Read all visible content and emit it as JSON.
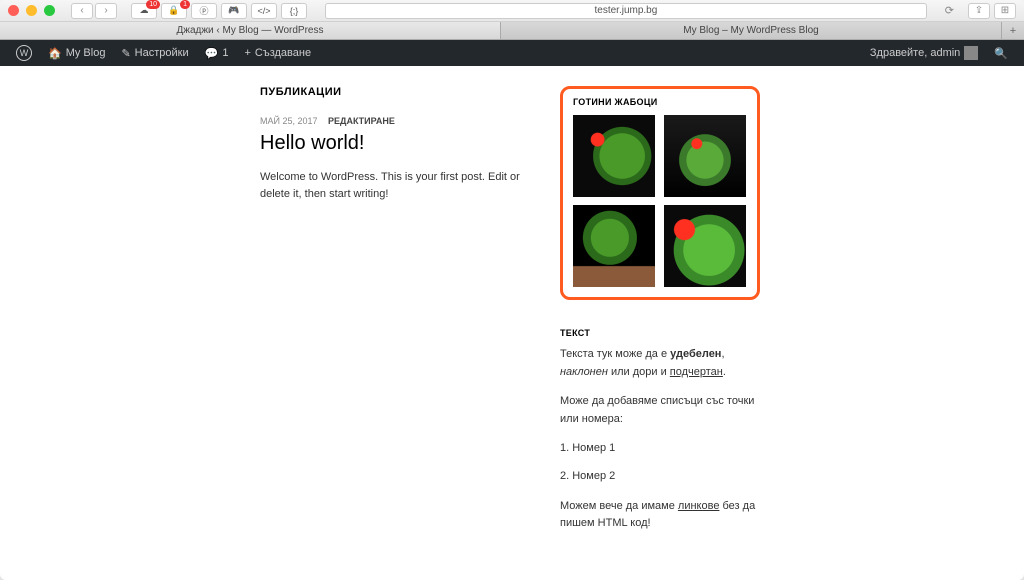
{
  "browser": {
    "url": "tester.jump.bg",
    "notif_badge1": "10",
    "notif_badge2": "1",
    "tabs": [
      {
        "label": "Джаджи ‹ My Blog — WordPress",
        "active": true
      },
      {
        "label": "My Blog – My WordPress Blog",
        "active": false
      }
    ]
  },
  "adminbar": {
    "site_name": "My Blog",
    "customize": "Настройки",
    "comments_count": "1",
    "new": "Създаване",
    "greeting": "Здравейте, admin"
  },
  "main": {
    "heading": "ПУБЛИКАЦИИ",
    "post": {
      "date": "МАЙ 25, 2017",
      "edit": "РЕДАКТИРАНЕ",
      "title": "Hello world!",
      "body": "Welcome to WordPress. This is your first post. Edit or delete it, then start writing!"
    }
  },
  "sidebar": {
    "gallery": {
      "title": "ГОТИНИ ЖАБОЦИ"
    },
    "text_widget": {
      "title": "ТЕКСТ",
      "p1_a": "Текста тук може да е ",
      "p1_bold": "удебелен",
      "p1_b": ", ",
      "p1_italic": "наклонен",
      "p1_c": " или дори и ",
      "p1_underline": "подчертан",
      "p1_d": ".",
      "p2": "Може да добавяме списъци със точки или номера:",
      "li1": "1. Номер 1",
      "li2": "2. Номер 2",
      "p3_a": "Можем вече да имаме ",
      "p3_link": "линкове",
      "p3_b": " без да пишем HTML код!"
    }
  }
}
